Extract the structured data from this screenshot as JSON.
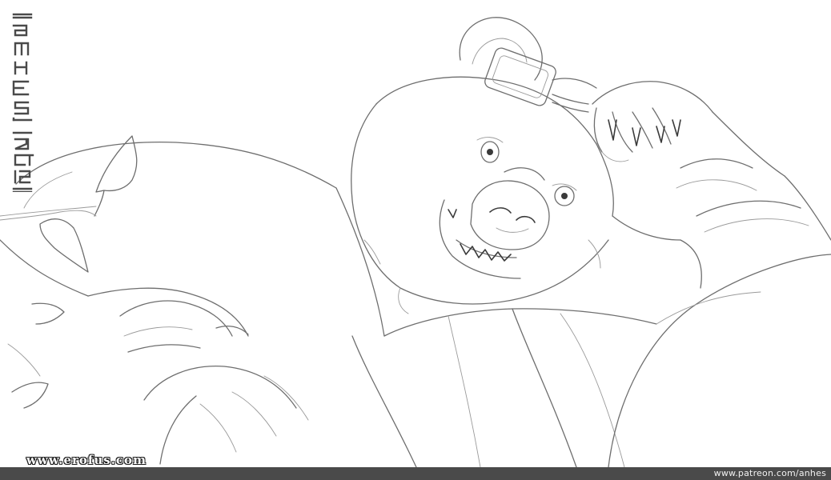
{
  "artwork": {
    "subject": "bear-lineart",
    "style": "pencil-lineart",
    "line_color": "#6e6e6e",
    "background_color": "#ffffff"
  },
  "signature": {
    "name_glyphs": "anhes",
    "date_glyphs": "2017 15"
  },
  "footer": {
    "url": "www.patreon.com/anhes",
    "bar_color": "#4a4a4a"
  },
  "watermark": {
    "text": "www.erofus.com"
  }
}
